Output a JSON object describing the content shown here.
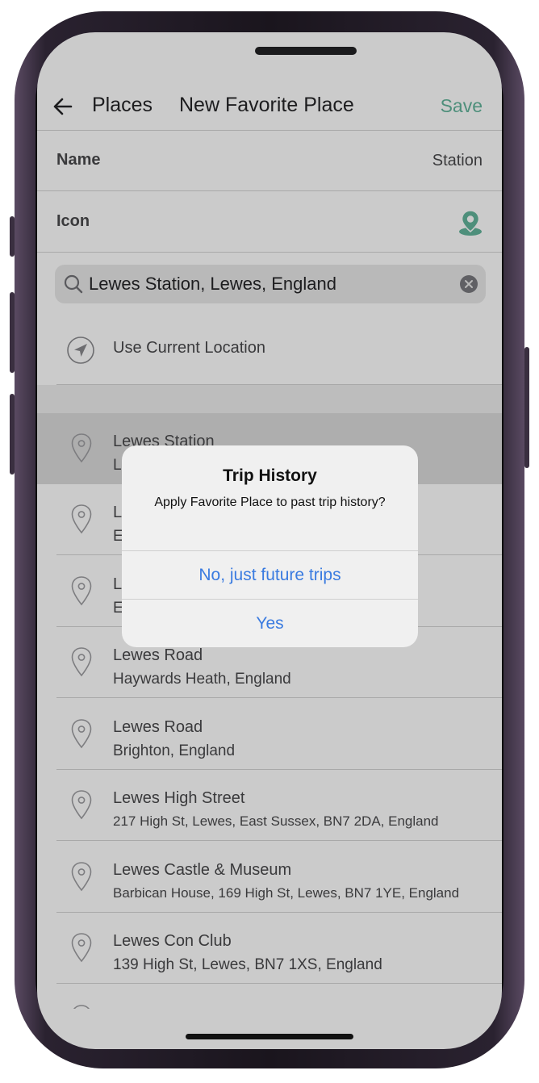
{
  "nav": {
    "back_icon": "back-arrow-icon",
    "parent": "Places",
    "title": "New Favorite Place",
    "save": "Save"
  },
  "form": {
    "name_label": "Name",
    "name_value": "Station",
    "icon_label": "Icon",
    "icon_value": "map-pin-icon",
    "accent": "#4e8f7b"
  },
  "search": {
    "value": "Lewes Station, Lewes, England",
    "icon": "search-icon",
    "clear_icon": "clear-icon"
  },
  "current_location": {
    "label": "Use Current Location",
    "icon": "location-arrow-icon"
  },
  "results": [
    {
      "title": "Lewes Station",
      "subtitle": "L"
    },
    {
      "title": "L",
      "subtitle": "E"
    },
    {
      "title": "L",
      "subtitle": "E"
    },
    {
      "title": "Lewes Road",
      "subtitle": "Haywards Heath, England"
    },
    {
      "title": "Lewes Road",
      "subtitle": "Brighton, England"
    },
    {
      "title": "Lewes High Street",
      "subtitle": "217 High St, Lewes, East Sussex, BN7 2DA, England"
    },
    {
      "title": "Lewes Castle & Museum",
      "subtitle": "Barbican House, 169 High St, Lewes, BN7 1YE, England"
    },
    {
      "title": "Lewes Con Club",
      "subtitle": "139 High St, Lewes, BN7 1XS, England"
    }
  ],
  "alert": {
    "title": "Trip History",
    "message": "Apply Favorite Place to past trip history?",
    "option_future": "No, just future trips",
    "option_yes": "Yes",
    "button_color": "#3a7be0"
  }
}
